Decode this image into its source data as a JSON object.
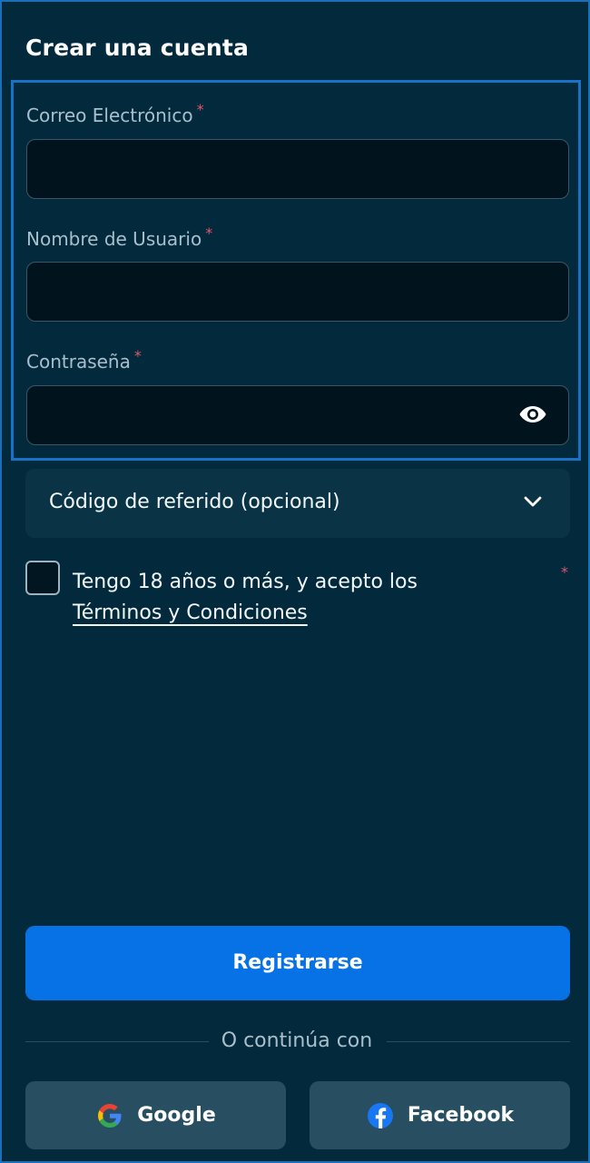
{
  "header": {
    "title": "Crear una cuenta"
  },
  "form": {
    "email": {
      "label": "Correo Electrónico",
      "required_mark": "*",
      "value": "",
      "placeholder": ""
    },
    "username": {
      "label": "Nombre de Usuario",
      "required_mark": "*",
      "value": "",
      "placeholder": ""
    },
    "password": {
      "label": "Contraseña",
      "required_mark": "*",
      "value": "",
      "placeholder": "",
      "toggle_icon": "eye-icon"
    }
  },
  "referral": {
    "label": "Código de referido (opcional)",
    "icon": "chevron-down-icon"
  },
  "terms": {
    "checked": false,
    "text": "Tengo 18 años o más, y acepto los",
    "link_text": "Términos y Condiciones",
    "required_mark": "*"
  },
  "actions": {
    "register_label": "Registrarse",
    "divider_text": "O continúa con",
    "google_label": "Google",
    "facebook_label": "Facebook"
  },
  "colors": {
    "background": "#022a3c",
    "accent": "#0772e6",
    "required": "#e2566a",
    "social_button": "#274f61"
  }
}
